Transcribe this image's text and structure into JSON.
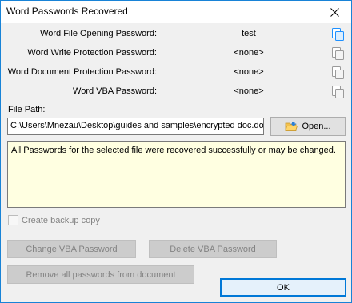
{
  "window": {
    "title": "Word Passwords Recovered"
  },
  "passwords": [
    {
      "label": "Word File Opening Password:",
      "value": "test",
      "copy_icon": "copy-icon"
    },
    {
      "label": "Word Write Protection Password:",
      "value": "<none>",
      "copy_icon": "copy-icon"
    },
    {
      "label": "Word Document Protection Password:",
      "value": "<none>",
      "copy_icon": "copy-icon"
    },
    {
      "label": "Word VBA Password:",
      "value": "<none>",
      "copy_icon": "copy-icon"
    }
  ],
  "file": {
    "label": "File Path:",
    "path": "C:\\Users\\Mnezau\\Desktop\\guides and samples\\encrypted doc.doc",
    "open_label": "Open..."
  },
  "status": {
    "message": "All Passwords for the selected file were recovered successfully or may be changed."
  },
  "options": {
    "backup_label": "Create backup copy",
    "backup_checked": false
  },
  "actions": {
    "change_vba": "Change VBA Password",
    "delete_vba": "Delete VBA Password",
    "remove_all": "Remove all passwords from document",
    "ok": "OK"
  },
  "colors": {
    "accent": "#0078d7",
    "status_bg": "#ffffe1",
    "active_copy_icon": "#1e90ff",
    "inactive_copy_icon": "#9a9a9a"
  }
}
